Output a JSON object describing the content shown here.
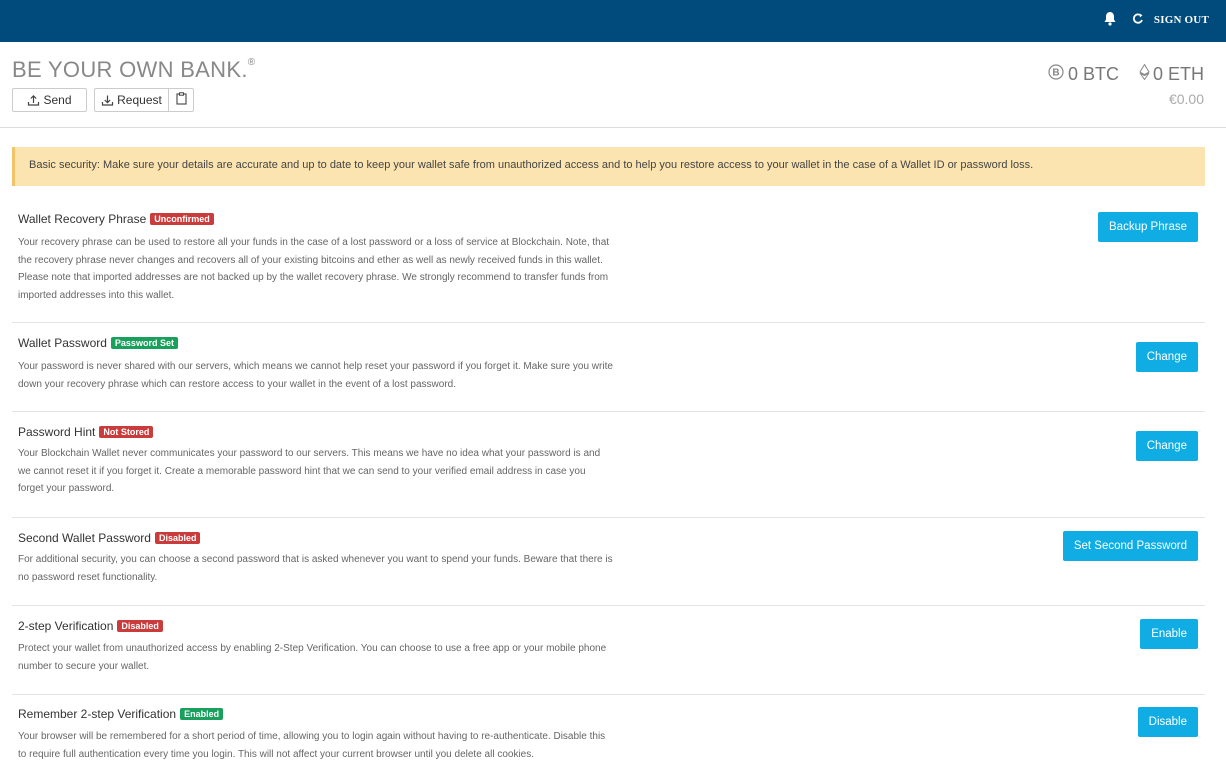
{
  "topbar": {
    "bell_icon": "bell-icon",
    "refresh_icon": "refresh-icon",
    "signout_label": "SIGN OUT"
  },
  "header": {
    "brand": "BE YOUR OWN BANK.",
    "brand_mark": "®",
    "send_label": "Send",
    "request_label": "Request",
    "btc_balance": "0 BTC",
    "eth_balance": "0 ETH",
    "fiat_balance": "€0.00"
  },
  "alert": {
    "text": "Basic security: Make sure your details are accurate and up to date to keep your wallet safe from unauthorized access and to help you restore access to your wallet in the case of a Wallet ID or password loss."
  },
  "sections": [
    {
      "title": "Wallet Recovery Phrase",
      "badge": "Unconfirmed",
      "badge_color": "#ca3b3b",
      "desc": "Your recovery phrase can be used to restore all your funds in the case of a lost password or a loss of service at Blockchain. Note, that the recovery phrase never changes and recovers all of your existing bitcoins and ether as well as newly received funds in this wallet. Please note that imported addresses are not backed up by the wallet recovery phrase. We strongly recommend to transfer funds from imported addresses into this wallet.",
      "button": "Backup Phrase"
    },
    {
      "title": "Wallet Password",
      "badge": "Password Set",
      "badge_color": "#18a05c",
      "desc": "Your password is never shared with our servers, which means we cannot help reset your password if you forget it. Make sure you write down your recovery phrase which can restore access to your wallet in the event of a lost password.",
      "button": "Change"
    },
    {
      "title": "Password Hint",
      "badge": "Not Stored",
      "badge_color": "#ca3b3b",
      "desc": "Your Blockchain Wallet never communicates your password to our servers. This means we have no idea what your password is and we cannot reset it if you forget it. Create a memorable password hint that we can send to your verified email address in case you forget your password.",
      "button": "Change"
    },
    {
      "title": "Second Wallet Password",
      "badge": "Disabled",
      "badge_color": "#ca3b3b",
      "desc": "For additional security, you can choose a second password that is asked whenever you want to spend your funds. Beware that there is no password reset functionality.",
      "button": "Set Second Password"
    },
    {
      "title": "2-step Verification",
      "badge": "Disabled",
      "badge_color": "#ca3b3b",
      "desc": "Protect your wallet from unauthorized access by enabling 2-Step Verification. You can choose to use a free app or your mobile phone number to secure your wallet.",
      "button": "Enable"
    },
    {
      "title": "Remember 2-step Verification",
      "badge": "Enabled",
      "badge_color": "#18a05c",
      "desc": "Your browser will be remembered for a short period of time, allowing you to login again without having to re-authenticate. Disable this to require full authentication every time you login. This will not affect your current browser until you delete all cookies.",
      "button": "Disable"
    }
  ]
}
